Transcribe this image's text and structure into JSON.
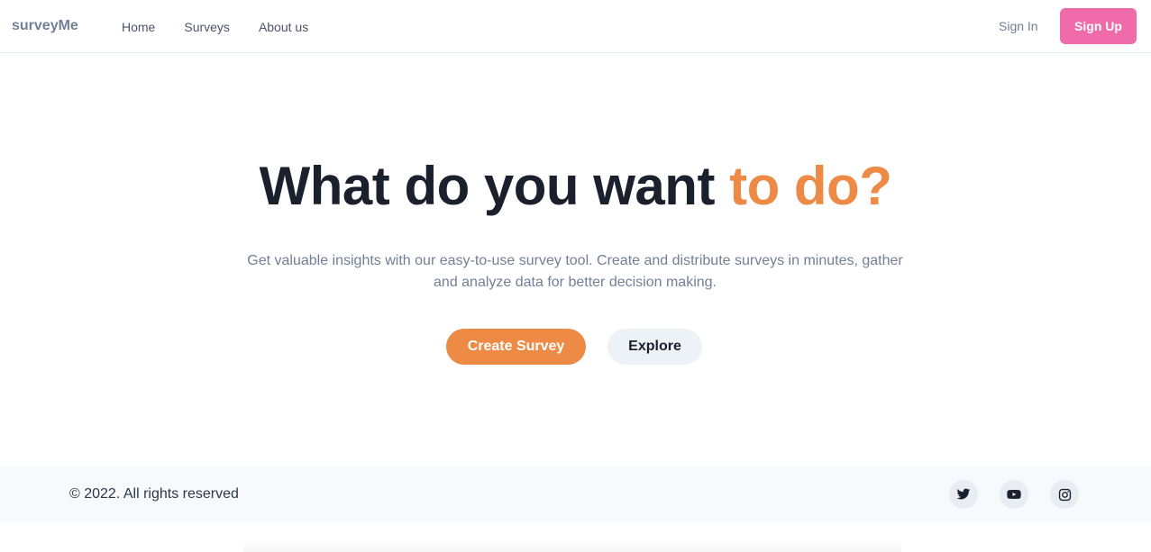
{
  "header": {
    "logo": "surveyMe",
    "nav": {
      "home": "Home",
      "surveys": "Surveys",
      "about": "About us"
    },
    "sign_in": "Sign In",
    "sign_up": "Sign Up"
  },
  "hero": {
    "title_main": "What do you want ",
    "title_accent": "to do?",
    "description": "Get valuable insights with our easy-to-use survey tool. Create and distribute surveys in minutes, gather and analyze data for better decision making.",
    "create_button": "Create Survey",
    "explore_button": "Explore"
  },
  "footer": {
    "copyright": "© 2022. All rights reserved",
    "social_icons": [
      "twitter-icon",
      "youtube-icon",
      "instagram-icon"
    ]
  },
  "colors": {
    "accent_orange": "#ed8a46",
    "signup_pink": "#f06ba9",
    "heading": "#1a202c",
    "muted_text": "#718096"
  }
}
